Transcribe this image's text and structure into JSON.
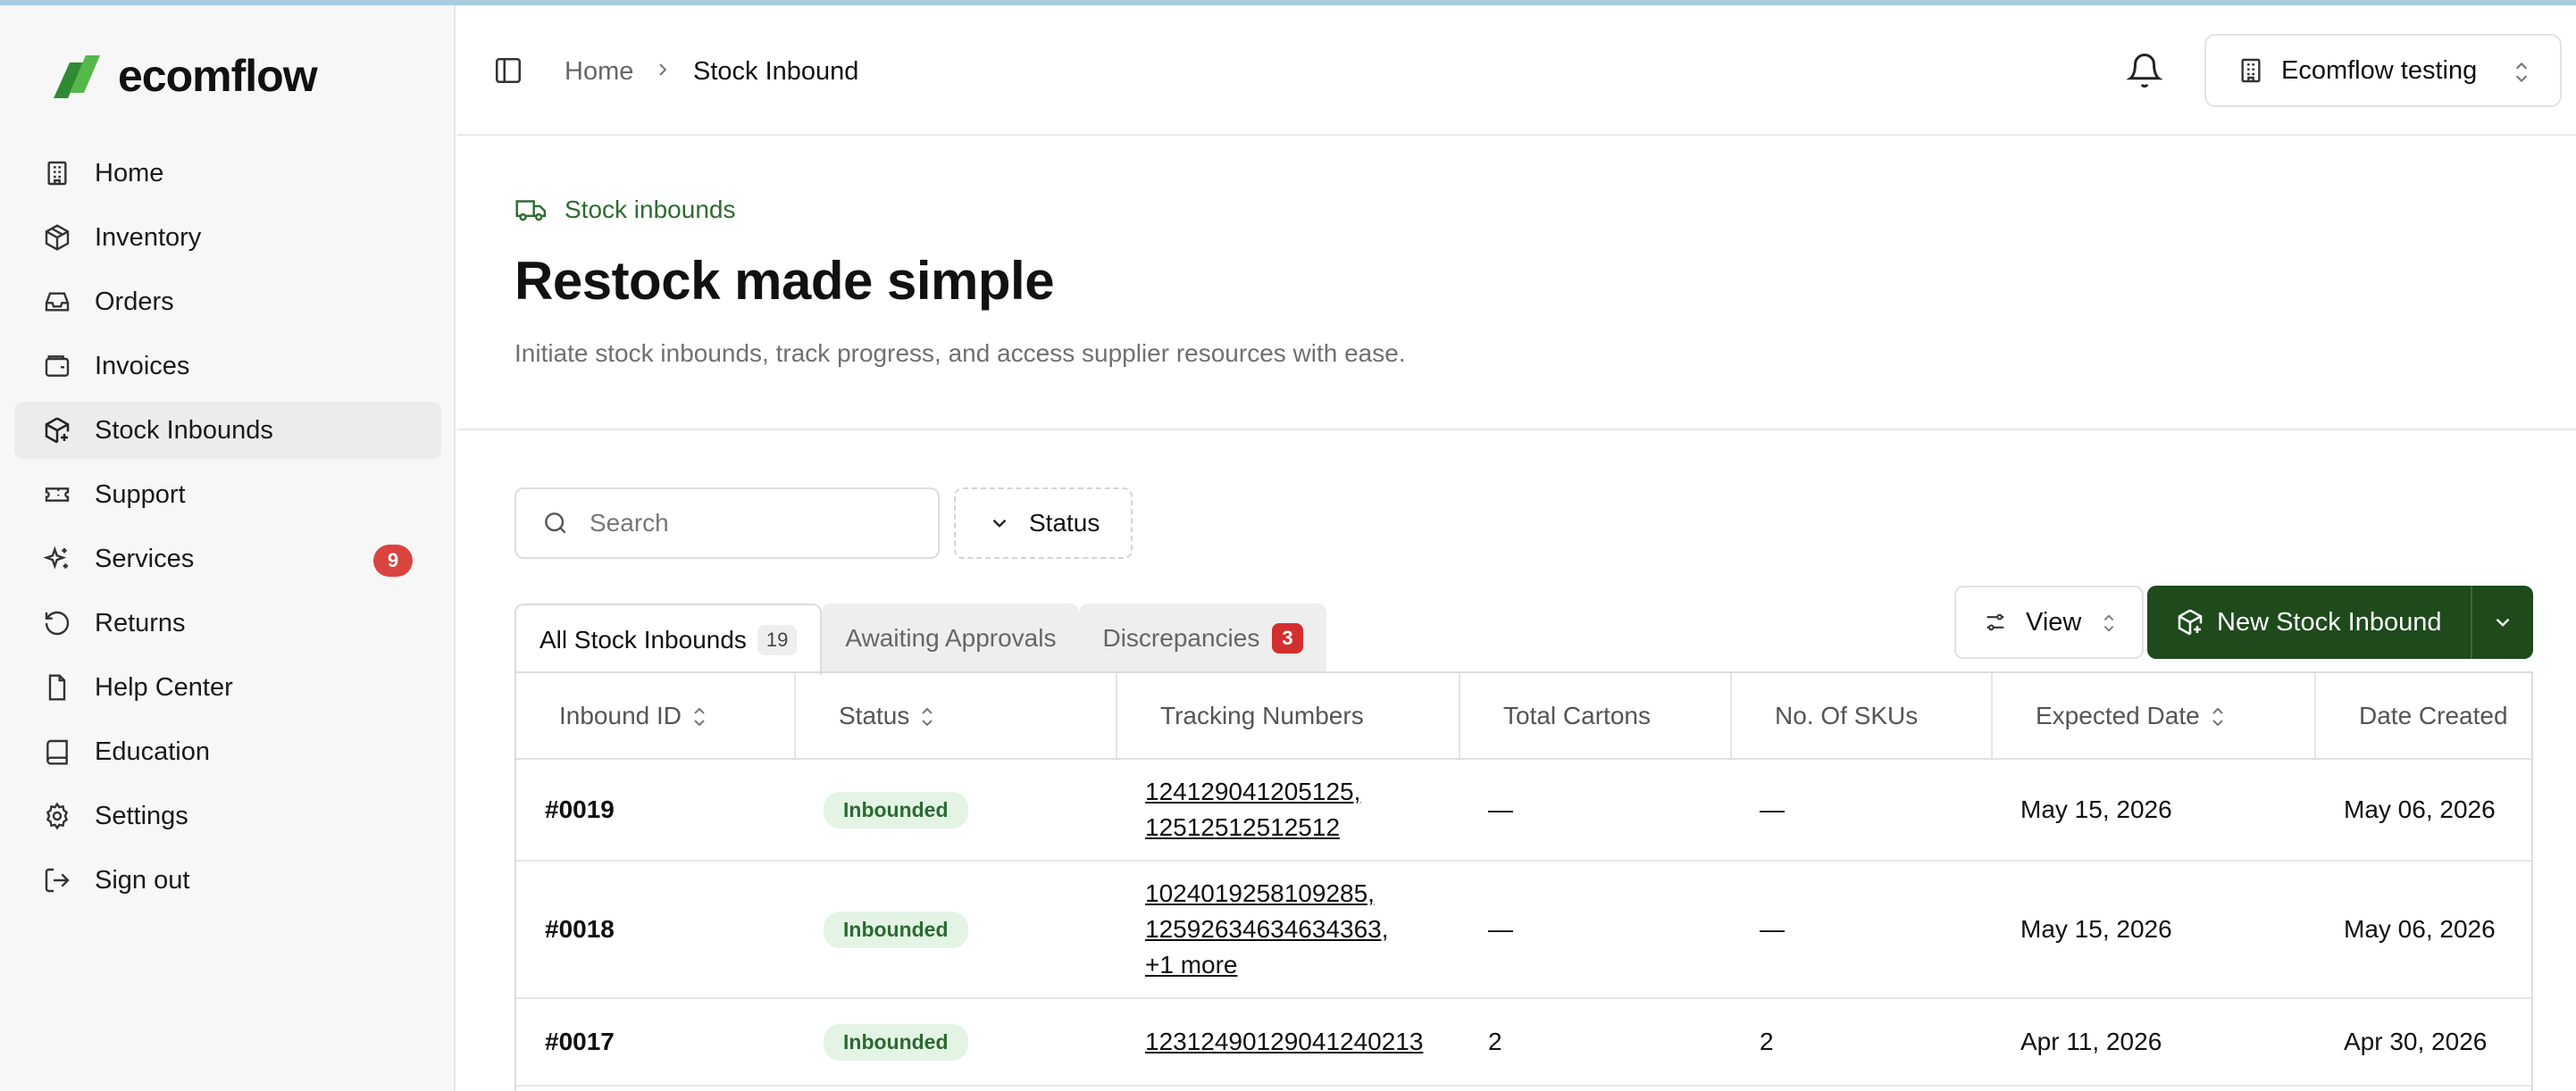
{
  "app": {
    "logo_text": "ecomflow"
  },
  "sidebar": {
    "items": [
      {
        "label": "Home",
        "icon": "building-icon"
      },
      {
        "label": "Inventory",
        "icon": "package-icon"
      },
      {
        "label": "Orders",
        "icon": "inbox-icon"
      },
      {
        "label": "Invoices",
        "icon": "wallet-icon"
      },
      {
        "label": "Stock Inbounds",
        "icon": "package-plus-icon",
        "active": true
      },
      {
        "label": "Support",
        "icon": "ticket-icon"
      },
      {
        "label": "Services",
        "icon": "sparkles-icon",
        "badge": "9"
      },
      {
        "label": "Returns",
        "icon": "rotate-ccw-icon"
      },
      {
        "label": "Help Center",
        "icon": "file-icon"
      },
      {
        "label": "Education",
        "icon": "book-icon"
      },
      {
        "label": "Settings",
        "icon": "gear-icon"
      },
      {
        "label": "Sign out",
        "icon": "log-out-icon"
      }
    ]
  },
  "topbar": {
    "breadcrumb": {
      "home": "Home",
      "current": "Stock Inbound"
    },
    "org_name": "Ecomflow testing"
  },
  "header": {
    "eyebrow": "Stock inbounds",
    "title": "Restock made simple",
    "subtitle": "Initiate stock inbounds, track progress, and access supplier resources with ease."
  },
  "filters": {
    "search_placeholder": "Search",
    "status_label": "Status"
  },
  "tabs": [
    {
      "label": "All Stock Inbounds",
      "count": "19",
      "active": true
    },
    {
      "label": "Awaiting Approvals"
    },
    {
      "label": "Discrepancies",
      "count": "3"
    }
  ],
  "actions": {
    "view_label": "View",
    "new_label": "New Stock Inbound"
  },
  "table": {
    "columns": [
      "Inbound ID",
      "Status",
      "Tracking Numbers",
      "Total Cartons",
      "No. Of SKUs",
      "Expected Date",
      "Date Created"
    ],
    "rows": [
      {
        "id": "#0019",
        "status": "Inbounded",
        "tracking": [
          "124129041205125,",
          "12512512512512"
        ],
        "cartons": "—",
        "skus": "—",
        "expected": "May 15, 2026",
        "created": "May 06, 2026"
      },
      {
        "id": "#0018",
        "status": "Inbounded",
        "tracking": [
          "1024019258109285,",
          "12592634634634363,",
          "+1 more"
        ],
        "cartons": "—",
        "skus": "—",
        "expected": "May 15, 2026",
        "created": "May 06, 2026"
      },
      {
        "id": "#0017",
        "status": "Inbounded",
        "tracking": [
          "12312490129041240213"
        ],
        "cartons": "2",
        "skus": "2",
        "expected": "Apr 11, 2026",
        "created": "Apr 30, 2026"
      }
    ]
  },
  "colors": {
    "brand_green": "#1e4a1c",
    "accent_green": "#2f6b32",
    "badge_red": "#d9443f",
    "status_bg": "#e3f4e5"
  }
}
